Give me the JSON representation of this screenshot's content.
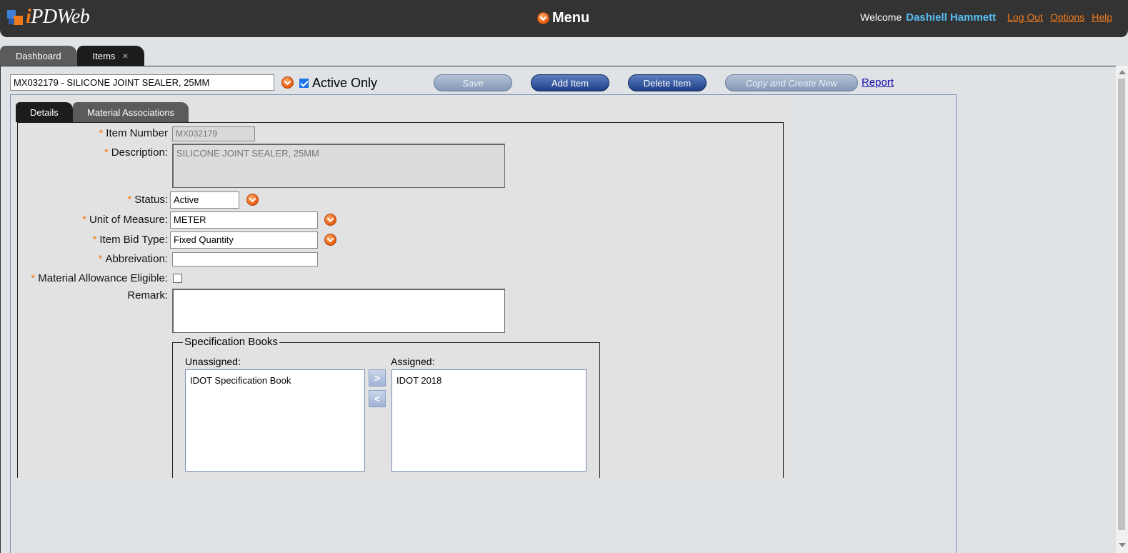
{
  "header": {
    "logo_i": "i",
    "logo_rest": "PDWeb",
    "menu_label": "Menu",
    "welcome": "Welcome",
    "user_name": "Dashiell Hammett",
    "links": [
      "Log Out",
      "Options",
      "Help"
    ]
  },
  "app_tabs": [
    {
      "label": "Dashboard",
      "active": false
    },
    {
      "label": "Items",
      "active": true,
      "close": "×"
    }
  ],
  "toolbar": {
    "item_selector_value": "MX032179 - SILICONE JOINT SEALER, 25MM",
    "active_only_label": "Active Only",
    "active_only_checked": true,
    "save_label": "Save",
    "add_item_label": "Add Item",
    "delete_item_label": "Delete Item",
    "copy_create_label": "Copy and Create New",
    "report_label": "Report"
  },
  "sub_tabs": [
    {
      "label": "Details",
      "active": true
    },
    {
      "label": "Material Associations",
      "active": false
    }
  ],
  "form": {
    "required_mark": "*",
    "item_number_label": "Item Number",
    "item_number_value": "MX032179",
    "description_label": "Description:",
    "description_value": "SILICONE JOINT SEALER, 25MM",
    "status_label": "Status:",
    "status_value": "Active",
    "uom_label": "Unit of Measure:",
    "uom_value": "METER",
    "bid_type_label": "Item Bid Type:",
    "bid_type_value": "Fixed Quantity",
    "abbreviation_label": "Abbreivation:",
    "abbreviation_value": "",
    "material_allowance_label": "Material Allowance Eligible:",
    "material_allowance_checked": false,
    "remark_label": "Remark:",
    "remark_value": ""
  },
  "spec_books": {
    "legend": "Specification Books",
    "unassigned_label": "Unassigned:",
    "unassigned_items": [
      "IDOT Specification Book"
    ],
    "assigned_label": "Assigned:",
    "assigned_items": [
      "IDOT 2018"
    ],
    "move_right_glyph": ">",
    "move_left_glyph": "<"
  },
  "colors": {
    "header_bg": "#333333",
    "accent_orange": "#f07b1b",
    "user_blue": "#57bdf2",
    "button_blue": "#1e3f86"
  }
}
